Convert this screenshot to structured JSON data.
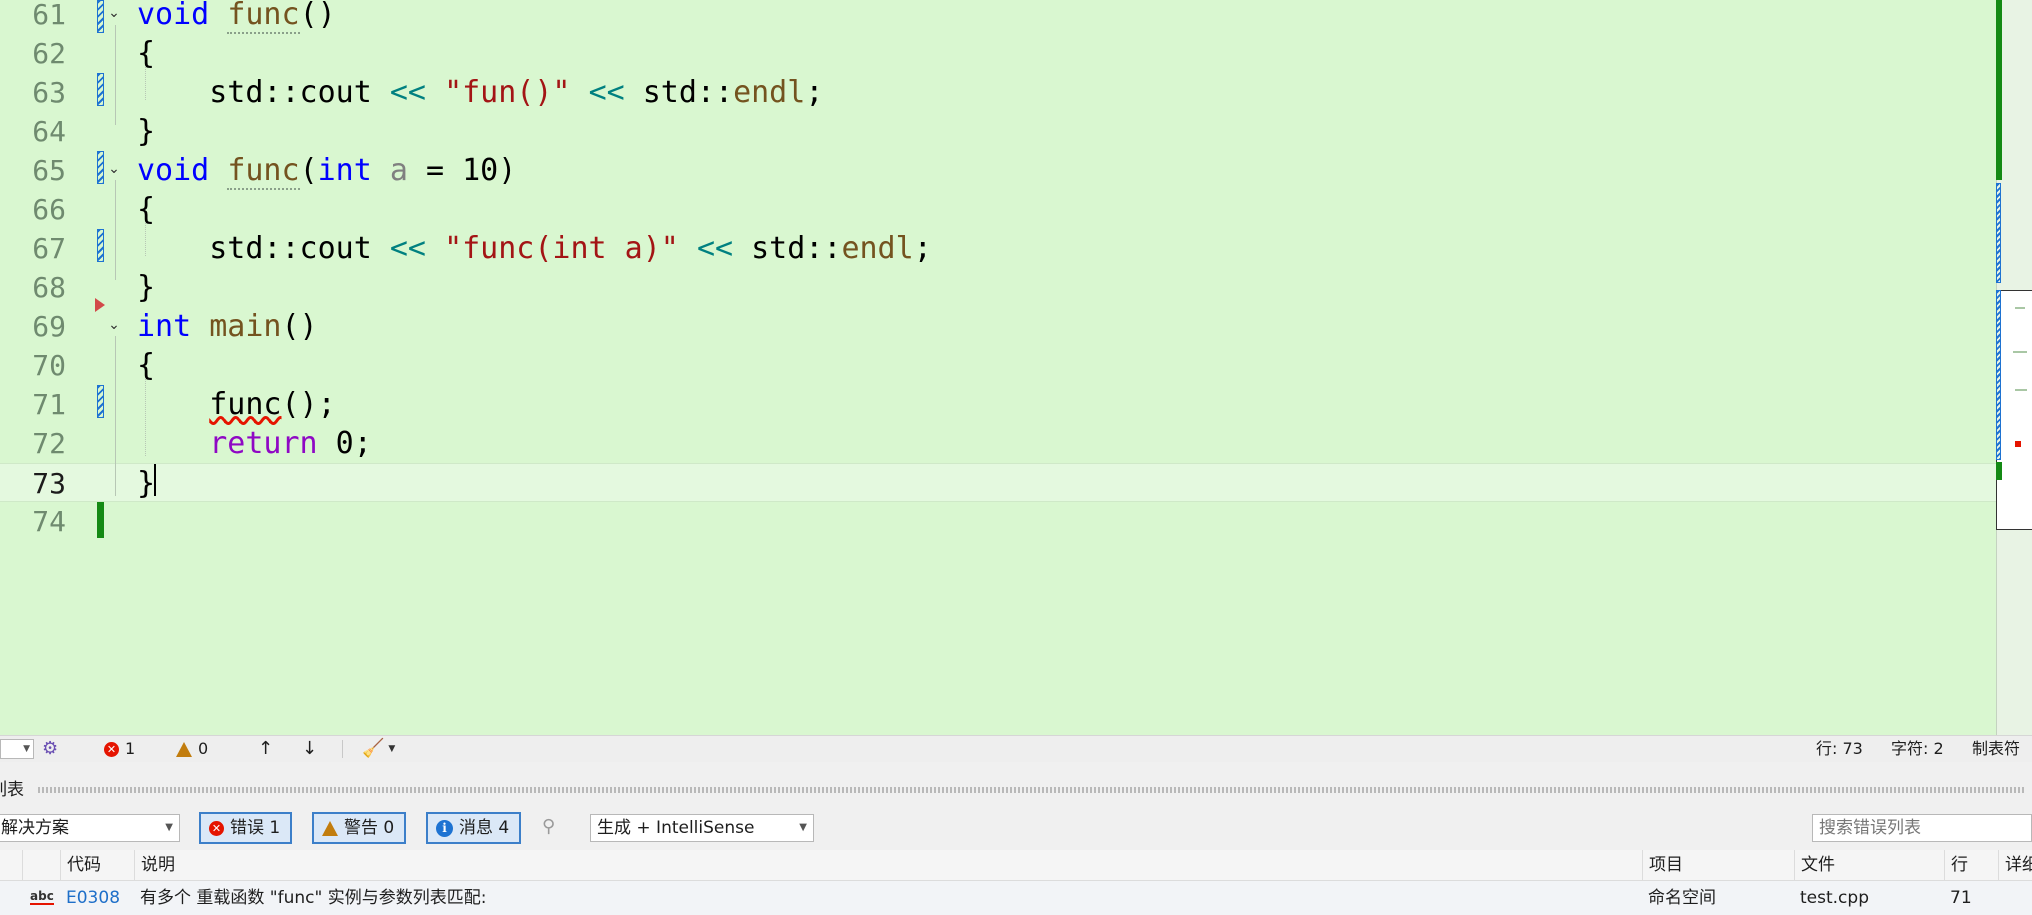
{
  "editor": {
    "lines": [
      {
        "num": "61",
        "tokens": [
          {
            "t": "void",
            "c": "kw"
          },
          {
            "t": " "
          },
          {
            "t": "func",
            "c": "fn dotu"
          },
          {
            "t": "()"
          }
        ]
      },
      {
        "num": "62",
        "tokens": [
          {
            "t": "{"
          }
        ]
      },
      {
        "num": "63",
        "tokens": [
          {
            "t": "    std::cout "
          },
          {
            "t": "<<",
            "c": "op"
          },
          {
            "t": " "
          },
          {
            "t": "\"fun()\"",
            "c": "str"
          },
          {
            "t": " "
          },
          {
            "t": "<<",
            "c": "op"
          },
          {
            "t": " std::"
          },
          {
            "t": "endl",
            "c": "fn"
          },
          {
            "t": ";"
          }
        ]
      },
      {
        "num": "64",
        "tokens": [
          {
            "t": "}"
          }
        ]
      },
      {
        "num": "65",
        "tokens": [
          {
            "t": "void",
            "c": "kw"
          },
          {
            "t": " "
          },
          {
            "t": "func",
            "c": "fn dotu"
          },
          {
            "t": "("
          },
          {
            "t": "int",
            "c": "kw"
          },
          {
            "t": " "
          },
          {
            "t": "a",
            "c": "prm"
          },
          {
            "t": " = 10)"
          }
        ]
      },
      {
        "num": "66",
        "tokens": [
          {
            "t": "{"
          }
        ]
      },
      {
        "num": "67",
        "tokens": [
          {
            "t": "    std::cout "
          },
          {
            "t": "<<",
            "c": "op"
          },
          {
            "t": " "
          },
          {
            "t": "\"func(int a)\"",
            "c": "str"
          },
          {
            "t": " "
          },
          {
            "t": "<<",
            "c": "op"
          },
          {
            "t": " std::"
          },
          {
            "t": "endl",
            "c": "fn"
          },
          {
            "t": ";"
          }
        ]
      },
      {
        "num": "68",
        "tokens": [
          {
            "t": "}"
          }
        ]
      },
      {
        "num": "69",
        "tokens": [
          {
            "t": "int",
            "c": "kw"
          },
          {
            "t": " "
          },
          {
            "t": "main",
            "c": "fn"
          },
          {
            "t": "()"
          }
        ]
      },
      {
        "num": "70",
        "tokens": [
          {
            "t": "{"
          }
        ]
      },
      {
        "num": "71",
        "tokens": [
          {
            "t": "    "
          },
          {
            "t": "func",
            "c": "squig"
          },
          {
            "t": "();"
          }
        ]
      },
      {
        "num": "72",
        "tokens": [
          {
            "t": "    "
          },
          {
            "t": "return",
            "c": "kwp"
          },
          {
            "t": " 0;"
          }
        ]
      },
      {
        "num": "73",
        "tokens": [
          {
            "t": "}"
          }
        ]
      },
      {
        "num": "74",
        "tokens": []
      }
    ],
    "current_line": "73"
  },
  "statusbar": {
    "errors": "1",
    "warnings": "0",
    "line_col": "行: 73",
    "char_col": "字符: 2",
    "indent": "制表符"
  },
  "panel": {
    "title": "列表",
    "scope": "解决方案",
    "errors_btn": "错误 1",
    "warnings_btn": "警告 0",
    "messages_btn": "消息 4",
    "source": "生成 + IntelliSense",
    "search_placeholder": "搜索错误列表"
  },
  "table": {
    "headers": {
      "code": "代码",
      "desc": "说明",
      "project": "项目",
      "file": "文件",
      "line": "行",
      "detail": "详细"
    },
    "rows": [
      {
        "code": "E0308",
        "desc": "有多个 重载函数 \"func\" 实例与参数列表匹配:",
        "project": "命名空间",
        "file": "test.cpp",
        "line": "71"
      }
    ]
  },
  "colors": {
    "editor_bg": "#d9f7d0",
    "keyword": "#0000ff",
    "control_keyword": "#8f08c4",
    "function": "#74531f",
    "string": "#a31515",
    "operator": "#008080",
    "error": "#e51400",
    "accent": "#1e73d2"
  }
}
